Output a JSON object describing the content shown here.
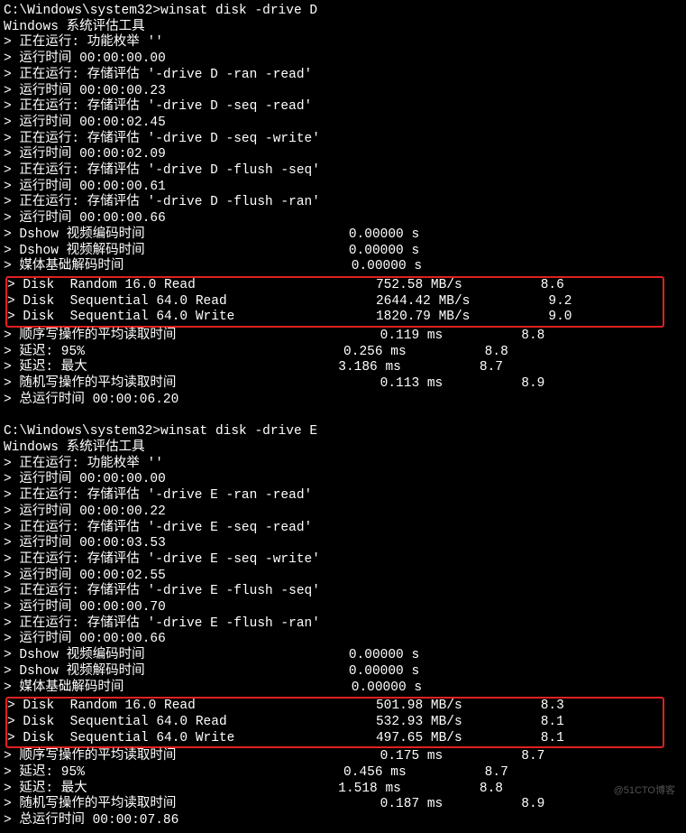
{
  "watermark": "@51CTO博客",
  "d": {
    "prompt": "C:\\Windows\\system32>winsat disk -drive D",
    "tool": "Windows 系统评估工具",
    "run1": "> 正在运行: 功能枚举 ''",
    "time1": "> 运行时间 00:00:00.00",
    "run2": "> 正在运行: 存储评估 '-drive D -ran -read'",
    "time2": "> 运行时间 00:00:00.23",
    "run3": "> 正在运行: 存储评估 '-drive D -seq -read'",
    "time3": "> 运行时间 00:00:02.45",
    "run4": "> 正在运行: 存储评估 '-drive D -seq -write'",
    "time4": "> 运行时间 00:00:02.09",
    "run5": "> 正在运行: 存储评估 '-drive D -flush -seq'",
    "time5": "> 运行时间 00:00:00.61",
    "run6": "> 正在运行: 存储评估 '-drive D -flush -ran'",
    "time6": "> 运行时间 00:00:00.66",
    "dshow1": "> Dshow 视频编码时间                          0.00000 s",
    "dshow2": "> Dshow 视频解码时间                          0.00000 s",
    "media": "> 媒体基础解码时间                             0.00000 s",
    "disk1": "> Disk  Random 16.0 Read                       752.58 MB/s          8.6",
    "disk2": "> Disk  Sequential 64.0 Read                   2644.42 MB/s          9.2",
    "disk3": "> Disk  Sequential 64.0 Write                  1820.79 MB/s          9.0",
    "seq": "> 顺序写操作的平均读取时间                          0.119 ms          8.8",
    "lat95": "> 延迟: 95%                                 0.256 ms          8.8",
    "latmax": "> 延迟: 最大                                3.186 ms          8.7",
    "rand": "> 随机写操作的平均读取时间                          0.113 ms          8.9",
    "total": "> 总运行时间 00:00:06.20"
  },
  "e": {
    "prompt": "C:\\Windows\\system32>winsat disk -drive E",
    "tool": "Windows 系统评估工具",
    "run1": "> 正在运行: 功能枚举 ''",
    "time1": "> 运行时间 00:00:00.00",
    "run2": "> 正在运行: 存储评估 '-drive E -ran -read'",
    "time2": "> 运行时间 00:00:00.22",
    "run3": "> 正在运行: 存储评估 '-drive E -seq -read'",
    "time3": "> 运行时间 00:00:03.53",
    "run4": "> 正在运行: 存储评估 '-drive E -seq -write'",
    "time4": "> 运行时间 00:00:02.55",
    "run5": "> 正在运行: 存储评估 '-drive E -flush -seq'",
    "time5": "> 运行时间 00:00:00.70",
    "run6": "> 正在运行: 存储评估 '-drive E -flush -ran'",
    "time6": "> 运行时间 00:00:00.66",
    "dshow1": "> Dshow 视频编码时间                          0.00000 s",
    "dshow2": "> Dshow 视频解码时间                          0.00000 s",
    "media": "> 媒体基础解码时间                             0.00000 s",
    "disk1": "> Disk  Random 16.0 Read                       501.98 MB/s          8.3",
    "disk2": "> Disk  Sequential 64.0 Read                   532.93 MB/s          8.1",
    "disk3": "> Disk  Sequential 64.0 Write                  497.65 MB/s          8.1",
    "seq": "> 顺序写操作的平均读取时间                          0.175 ms          8.7",
    "lat95": "> 延迟: 95%                                 0.456 ms          8.7",
    "latmax": "> 延迟: 最大                                1.518 ms          8.8",
    "rand": "> 随机写操作的平均读取时间                          0.187 ms          8.9",
    "total": "> 总运行时间 00:00:07.86"
  },
  "chart_data": [
    {
      "type": "table",
      "title": "winsat disk -drive D",
      "rows": [
        {
          "metric": "Disk Random 16.0 Read",
          "value": "752.58 MB/s",
          "score": 8.6
        },
        {
          "metric": "Disk Sequential 64.0 Read",
          "value": "2644.42 MB/s",
          "score": 9.2
        },
        {
          "metric": "Disk Sequential 64.0 Write",
          "value": "1820.79 MB/s",
          "score": 9.0
        },
        {
          "metric": "顺序写操作的平均读取时间",
          "value": "0.119 ms",
          "score": 8.8
        },
        {
          "metric": "延迟: 95%",
          "value": "0.256 ms",
          "score": 8.8
        },
        {
          "metric": "延迟: 最大",
          "value": "3.186 ms",
          "score": 8.7
        },
        {
          "metric": "随机写操作的平均读取时间",
          "value": "0.113 ms",
          "score": 8.9
        }
      ]
    },
    {
      "type": "table",
      "title": "winsat disk -drive E",
      "rows": [
        {
          "metric": "Disk Random 16.0 Read",
          "value": "501.98 MB/s",
          "score": 8.3
        },
        {
          "metric": "Disk Sequential 64.0 Read",
          "value": "532.93 MB/s",
          "score": 8.1
        },
        {
          "metric": "Disk Sequential 64.0 Write",
          "value": "497.65 MB/s",
          "score": 8.1
        },
        {
          "metric": "顺序写操作的平均读取时间",
          "value": "0.175 ms",
          "score": 8.7
        },
        {
          "metric": "延迟: 95%",
          "value": "0.456 ms",
          "score": 8.7
        },
        {
          "metric": "延迟: 最大",
          "value": "1.518 ms",
          "score": 8.8
        },
        {
          "metric": "随机写操作的平均读取时间",
          "value": "0.187 ms",
          "score": 8.9
        }
      ]
    }
  ]
}
